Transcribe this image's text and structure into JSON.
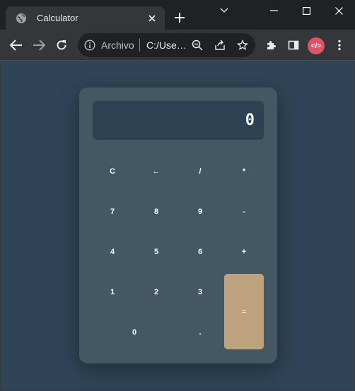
{
  "browser": {
    "tab_title": "Calculator",
    "omnibox_chip": "Archivo",
    "url": "C:/Use…",
    "avatar_text": "</>"
  },
  "colors": {
    "page_bg": "#2f4457",
    "calculator_bg": "#435863",
    "display_bg": "#2c4252",
    "equals_bg": "#bda27d",
    "avatar_bg": "#e05264"
  },
  "calculator": {
    "display_value": "0",
    "keys": {
      "clear": "C",
      "backspace": "←",
      "divide": "/",
      "multiply": "*",
      "seven": "7",
      "eight": "8",
      "nine": "9",
      "minus": "-",
      "four": "4",
      "five": "5",
      "six": "6",
      "plus": "+",
      "one": "1",
      "two": "2",
      "three": "3",
      "equals": "=",
      "zero": "0",
      "decimal": "."
    }
  }
}
